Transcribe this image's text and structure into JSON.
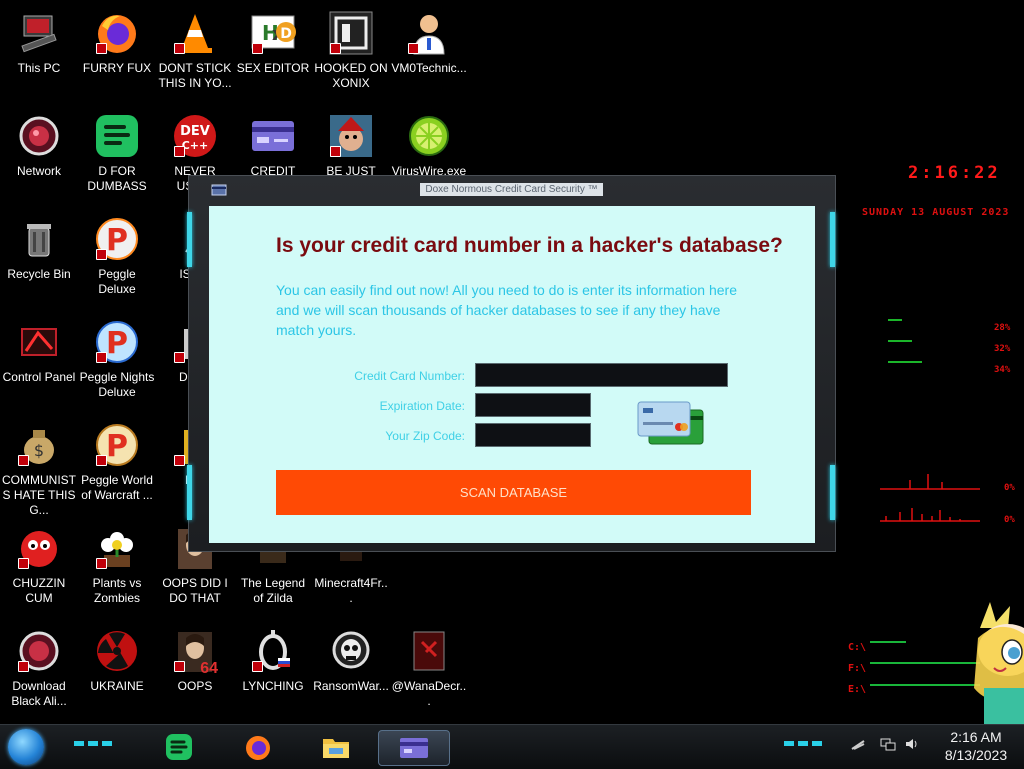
{
  "desktop": {
    "icons": [
      {
        "label": "This PC"
      },
      {
        "label": "FURRY FUX"
      },
      {
        "label": "DONT STICK THIS IN YO..."
      },
      {
        "label": "SEX EDITOR"
      },
      {
        "label": "HOOKED ON XONIX"
      },
      {
        "label": "VM0Technic..."
      },
      {
        "label": "Network"
      },
      {
        "label": "D FOR DUMBASS"
      },
      {
        "label": "NEVER USED!"
      },
      {
        "label": "CREDIT CARD"
      },
      {
        "label": "BE JUST LIKE"
      },
      {
        "label": "VirusWire.exe"
      },
      {
        "label": "Recycle Bin"
      },
      {
        "label": "Peggle Deluxe"
      },
      {
        "label": "ISRAI"
      },
      {
        "label": "Control Panel"
      },
      {
        "label": "Peggle Nights Deluxe"
      },
      {
        "label": "DEEZ"
      },
      {
        "label": "COMMUNISTS HATE THIS G..."
      },
      {
        "label": "Peggle World of Warcraft ..."
      },
      {
        "label": "DIE"
      },
      {
        "label": "CHUZZIN CUM"
      },
      {
        "label": "Plants vs Zombies"
      },
      {
        "label": "OOPS DID I DO THAT"
      },
      {
        "label": "The Legend of Zilda"
      },
      {
        "label": "Minecraft4Fr..."
      },
      {
        "label": "Download Black Ali..."
      },
      {
        "label": "UKRAINE"
      },
      {
        "label": "OOPS"
      },
      {
        "label": "LYNCHING"
      },
      {
        "label": "RansomWar..."
      },
      {
        "label": "@WanaDecr..."
      }
    ],
    "oops_overlay": "64"
  },
  "widgets": {
    "clock": "2:16:22",
    "date": "SUNDAY 13 AUGUST 2023",
    "meters": [
      "28%",
      "32%",
      "34%"
    ],
    "graphs": [
      "0%",
      "0%"
    ],
    "drives": [
      "C:\\",
      "F:\\",
      "E:\\"
    ]
  },
  "window": {
    "title": "Doxe Normous Credit Card Security ™",
    "headline": "Is your credit card number in a hacker's database?",
    "description": "You can easily find out now! All you need to do is enter its information here and we will scan thousands of hacker databases to see if any they have match yours.",
    "form": {
      "card_number_label": "Credit Card Number:",
      "card_number_value": "",
      "expiration_label": "Expiration Date:",
      "expiration_value": "",
      "zip_label": "Your Zip Code:",
      "zip_value": ""
    },
    "scan_button": "SCAN DATABASE"
  },
  "taskbar": {
    "time": "2:16 AM",
    "date": "8/13/2023"
  },
  "colors": {
    "content_bg": "#d2fbf8",
    "headline": "#7a0b10",
    "accent_cyan": "#2cc6e6",
    "button": "#ff4a05"
  }
}
